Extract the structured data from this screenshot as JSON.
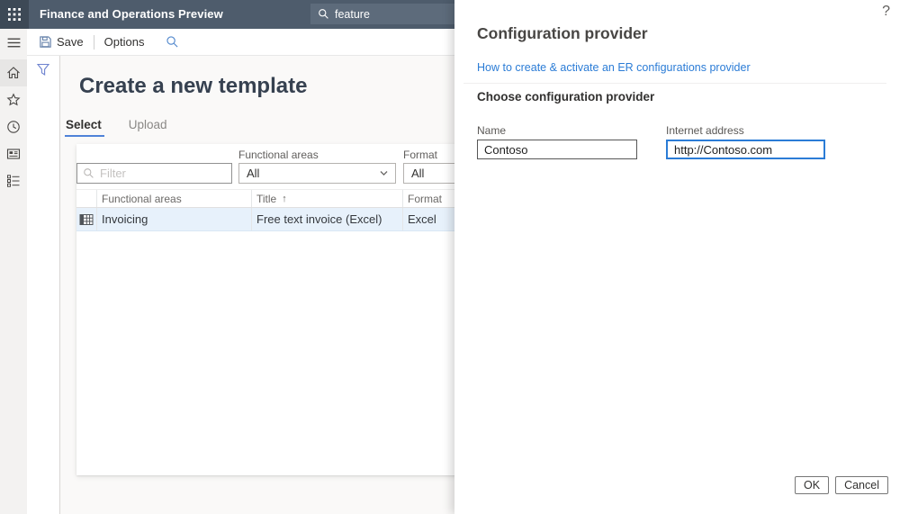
{
  "topbar": {
    "app_title": "Finance and Operations Preview",
    "search_value": "feature"
  },
  "toolbar": {
    "save_label": "Save",
    "options_label": "Options"
  },
  "sidebar": {
    "items": [
      "menu",
      "home",
      "favorites",
      "recent",
      "workspaces",
      "modules"
    ]
  },
  "main": {
    "title": "Create a new template",
    "tabs": [
      {
        "label": "Select",
        "active": true
      },
      {
        "label": "Upload",
        "active": false
      }
    ],
    "filters": {
      "filter_placeholder": "Filter",
      "functional_areas_label": "Functional areas",
      "functional_areas_value": "All",
      "format_label": "Format",
      "format_value": "All"
    },
    "table": {
      "headers": {
        "functional_areas": "Functional areas",
        "title": "Title",
        "format": "Format"
      },
      "sort_arrow": "↑",
      "rows": [
        {
          "functional_areas": "Invoicing",
          "title": "Free text invoice (Excel)",
          "format": "Excel"
        }
      ]
    }
  },
  "panel": {
    "help_icon": "?",
    "title": "Configuration provider",
    "link_text": "How to create & activate an ER configurations provider",
    "section_title": "Choose configuration provider",
    "name_label": "Name",
    "name_value": "Contoso",
    "address_label": "Internet address",
    "address_value": "http://Contoso.com",
    "ok_label": "OK",
    "cancel_label": "Cancel"
  },
  "colors": {
    "topbar_bg": "#4e5c6c",
    "topbar_tile_bg": "#3d4956",
    "accent_blue": "#2b7cd6",
    "tab_underline": "#4f82d8",
    "selected_row_bg": "#e7f1fb",
    "sidebar_bg": "#f3f2f1",
    "page_bg": "#faf9f8"
  }
}
